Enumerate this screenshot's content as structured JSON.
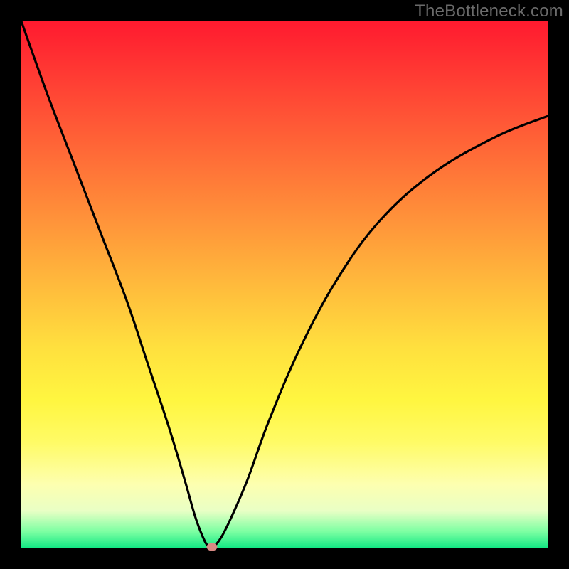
{
  "watermark": "TheBottleneck.com",
  "chart_data": {
    "type": "line",
    "title": "",
    "xlabel": "",
    "ylabel": "",
    "xlim": [
      0,
      100
    ],
    "ylim": [
      0,
      100
    ],
    "grid": false,
    "legend": false,
    "background": "gradient-red-to-green",
    "series": [
      {
        "name": "curve",
        "x": [
          0,
          5,
          10,
          15,
          20,
          24,
          28,
          31,
          33,
          34.5,
          35.5,
          36.5,
          38,
          40,
          43,
          47,
          53,
          60,
          68,
          78,
          90,
          100
        ],
        "y": [
          100,
          86,
          73,
          60,
          47,
          35,
          23,
          13,
          6,
          2,
          0.3,
          0.2,
          2,
          6,
          13,
          24,
          38,
          51,
          62,
          71,
          78,
          82
        ]
      }
    ],
    "marker": {
      "x": 36.2,
      "y": 0.2,
      "color": "#d98a84"
    },
    "gradient_stops": [
      {
        "pos": 0,
        "color": "#ff1a2f"
      },
      {
        "pos": 50,
        "color": "#ffba3c"
      },
      {
        "pos": 80,
        "color": "#fffb66"
      },
      {
        "pos": 100,
        "color": "#14e884"
      }
    ]
  }
}
